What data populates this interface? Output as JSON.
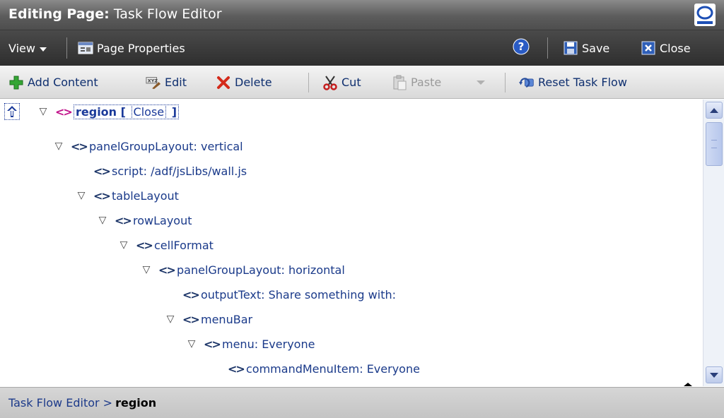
{
  "titlebar": {
    "title_prefix": "Editing Page:",
    "title": "Task Flow Editor",
    "logo_icon": "oracle-logo-icon"
  },
  "menubar": {
    "view_label": "View",
    "page_properties_label": "Page Properties",
    "help_icon": "help-icon",
    "save_label": "Save",
    "close_label": "Close"
  },
  "toolbar": {
    "add_content_label": "Add Content",
    "edit_label": "Edit",
    "delete_label": "Delete",
    "cut_label": "Cut",
    "paste_label": "Paste",
    "reset_label": "Reset Task Flow"
  },
  "tree": {
    "root": {
      "label": "region",
      "bracket_open": "[",
      "close_label": "Close",
      "bracket_close": "]"
    },
    "nodes": [
      {
        "label": "panelGroupLayout: vertical",
        "expanded": true
      },
      {
        "label": "script: /adf/jsLibs/wall.js",
        "expanded": false
      },
      {
        "label": "tableLayout",
        "expanded": true
      },
      {
        "label": "rowLayout",
        "expanded": true
      },
      {
        "label": "cellFormat",
        "expanded": true
      },
      {
        "label": "panelGroupLayout: horizontal",
        "expanded": true
      },
      {
        "label": "outputText: Share something with:",
        "expanded": false
      },
      {
        "label": "menuBar",
        "expanded": true
      },
      {
        "label": "menu: Everyone",
        "expanded": true
      },
      {
        "label": "commandMenuItem: Everyone",
        "expanded": false
      }
    ]
  },
  "statusbar": {
    "path": "Task Flow Editor >",
    "current": "region"
  },
  "colors": {
    "titlebar": "#5c5c5c",
    "menubar": "#2e2e2e",
    "link": "#1a3a8a",
    "active_tag": "#c1128a"
  }
}
